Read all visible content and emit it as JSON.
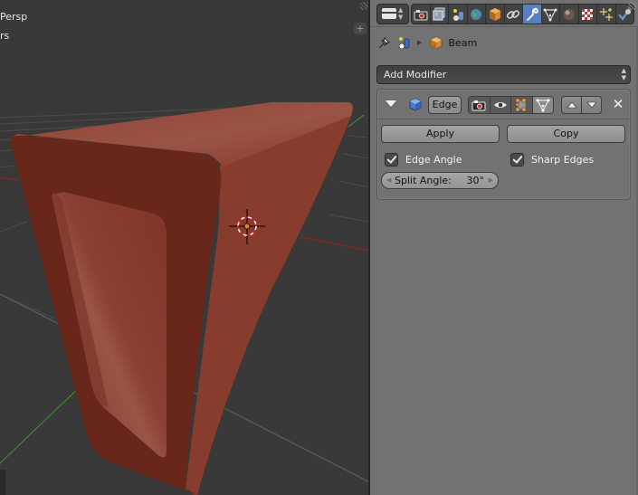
{
  "viewport": {
    "view_label": "Persp",
    "units_label": "rs",
    "add_region_icon": "+",
    "object_color": "#8a3a2c",
    "axis_colors": {
      "x": "#a02020",
      "y": "#3a9a2a"
    }
  },
  "properties": {
    "editor_type_icon": "properties-editor-icon",
    "context_tabs": [
      {
        "name": "render",
        "icon": "camera-icon",
        "active": false
      },
      {
        "name": "render-layers",
        "icon": "render-layers-icon",
        "active": false
      },
      {
        "name": "scene",
        "icon": "scene-icon",
        "active": false
      },
      {
        "name": "world",
        "icon": "world-icon",
        "active": false
      },
      {
        "name": "object",
        "icon": "object-cube-icon",
        "active": false
      },
      {
        "name": "constraints",
        "icon": "chain-link-icon",
        "active": false
      },
      {
        "name": "modifiers",
        "icon": "wrench-icon",
        "active": true
      },
      {
        "name": "data",
        "icon": "mesh-data-icon",
        "active": false
      },
      {
        "name": "material",
        "icon": "material-sphere-icon",
        "active": false
      },
      {
        "name": "texture",
        "icon": "checker-texture-icon",
        "active": false
      },
      {
        "name": "particles",
        "icon": "particles-icon",
        "active": false
      },
      {
        "name": "physics",
        "icon": "physics-icon",
        "active": false
      }
    ],
    "accent_color": "#5680c2",
    "breadcrumb": {
      "pin_icon": "pin-icon",
      "scene_icon": "scene-icon",
      "object_name": "Beam"
    },
    "add_modifier_label": "Add Modifier",
    "modifier": {
      "name": "Edge",
      "type_icon": "edge-split-icon",
      "expanded": true,
      "show_render": true,
      "show_viewport": true,
      "show_editmode": true,
      "show_on_cage": false,
      "apply_label": "Apply",
      "copy_label": "Copy",
      "edge_angle": {
        "label": "Edge Angle",
        "checked": true
      },
      "sharp_edges": {
        "label": "Sharp Edges",
        "checked": true
      },
      "split_angle": {
        "label": "Split Angle:",
        "value": "30°"
      }
    }
  }
}
